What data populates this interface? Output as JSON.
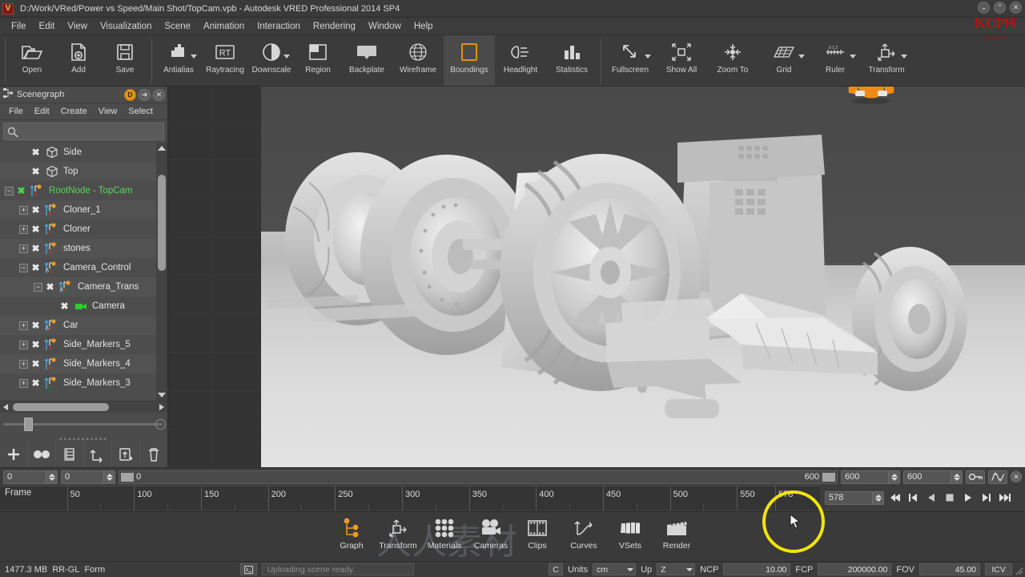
{
  "window": {
    "title": "D:/Work/VRed/Power vs Speed/Main Shot/TopCam.vpb - Autodesk VRED Professional 2014 SP4",
    "app_icon": "vred-icon",
    "controls": {
      "minimize": "⌄",
      "maximize": "⌃",
      "close": "✕"
    },
    "logo": "KUPH",
    "logo_sub": "video tutorials"
  },
  "menubar": {
    "items": [
      "File",
      "Edit",
      "View",
      "Visualization",
      "Scene",
      "Animation",
      "Interaction",
      "Rendering",
      "Window",
      "Help"
    ]
  },
  "toolbar": {
    "groups": [
      {
        "buttons": [
          {
            "label": "Open",
            "icon": "folder-open-icon",
            "caret": false,
            "active": false
          },
          {
            "label": "Add",
            "icon": "add-file-icon",
            "caret": false,
            "active": false
          },
          {
            "label": "Save",
            "icon": "floppy-disk-icon",
            "caret": false,
            "active": false
          }
        ]
      },
      {
        "buttons": [
          {
            "label": "Antialias",
            "icon": "antialias-icon",
            "caret": true,
            "active": false
          },
          {
            "label": "Raytracing",
            "icon": "rt-icon",
            "caret": false,
            "active": false
          },
          {
            "label": "Downscale",
            "icon": "downscale-icon",
            "caret": true,
            "active": false
          },
          {
            "label": "Region",
            "icon": "region-icon",
            "caret": false,
            "active": false
          },
          {
            "label": "Backplate",
            "icon": "backplate-icon",
            "caret": false,
            "active": false
          },
          {
            "label": "Wireframe",
            "icon": "wireframe-globe-icon",
            "caret": false,
            "active": false
          },
          {
            "label": "Boundings",
            "icon": "boundings-icon",
            "caret": false,
            "active": true
          },
          {
            "label": "Headlight",
            "icon": "headlight-icon",
            "caret": false,
            "active": false
          },
          {
            "label": "Statistics",
            "icon": "statistics-bars-icon",
            "caret": false,
            "active": false
          }
        ]
      },
      {
        "buttons": [
          {
            "label": "Fullscreen",
            "icon": "fullscreen-arrows-icon",
            "caret": true,
            "active": false
          },
          {
            "label": "Show All",
            "icon": "show-all-icon",
            "caret": false,
            "active": false
          },
          {
            "label": "Zoom To",
            "icon": "zoom-to-icon",
            "caret": false,
            "active": false
          },
          {
            "label": "Grid",
            "icon": "grid-plane-icon",
            "caret": true,
            "active": false
          },
          {
            "label": "Ruler",
            "icon": "ruler-icon",
            "caret": true,
            "active": false
          },
          {
            "label": "Transform",
            "icon": "transform-icon",
            "caret": true,
            "active": false
          }
        ]
      }
    ]
  },
  "scenegraph": {
    "title": "Scenegraph",
    "panel_icon": "scenegraph-icon",
    "header_buttons": [
      {
        "name": "dock-d-button",
        "glyph": "D"
      },
      {
        "name": "undock-button",
        "glyph": "➜"
      },
      {
        "name": "close-panel-button",
        "glyph": "✕"
      }
    ],
    "menu": [
      "File",
      "Edit",
      "Create",
      "View",
      "Select"
    ],
    "search": {
      "placeholder": "",
      "value": "",
      "icon": "search-icon"
    },
    "nodes": [
      {
        "label": "Side",
        "indent": 1,
        "expander": "none",
        "icon": "box-icon",
        "selected": false,
        "visible": true
      },
      {
        "label": "Top",
        "indent": 1,
        "expander": "none",
        "icon": "box-icon",
        "selected": false,
        "visible": true
      },
      {
        "label": "RootNode - TopCam",
        "indent": 0,
        "expander": "minus",
        "icon": "transform-node-icon",
        "selected": true,
        "visible": true
      },
      {
        "label": "Cloner_1",
        "indent": 1,
        "expander": "plus",
        "icon": "transform-node-icon",
        "selected": false,
        "visible": true
      },
      {
        "label": "Cloner",
        "indent": 1,
        "expander": "plus",
        "icon": "transform-node-icon",
        "selected": false,
        "visible": true
      },
      {
        "label": "stones",
        "indent": 1,
        "expander": "plus",
        "icon": "transform-node-icon",
        "selected": false,
        "visible": true
      },
      {
        "label": "Camera_Control",
        "indent": 1,
        "expander": "minus",
        "icon": "transform-anim-node-icon",
        "selected": false,
        "visible": true
      },
      {
        "label": "Camera_Trans",
        "indent": 2,
        "expander": "minus",
        "icon": "transform-anim-node-icon",
        "selected": false,
        "visible": true
      },
      {
        "label": "Camera",
        "indent": 3,
        "expander": "none",
        "icon": "camera-icon",
        "selected": false,
        "visible": true
      },
      {
        "label": "Car",
        "indent": 1,
        "expander": "plus",
        "icon": "transform-anim-node-icon",
        "selected": false,
        "visible": true
      },
      {
        "label": "Side_Markers_5",
        "indent": 1,
        "expander": "plus",
        "icon": "transform-node-icon",
        "selected": false,
        "visible": true
      },
      {
        "label": "Side_Markers_4",
        "indent": 1,
        "expander": "plus",
        "icon": "transform-node-icon",
        "selected": false,
        "visible": true
      },
      {
        "label": "Side_Markers_3",
        "indent": 1,
        "expander": "plus",
        "icon": "transform-node-icon",
        "selected": false,
        "visible": true
      }
    ],
    "bottom_buttons": [
      {
        "name": "add-node-button",
        "icon": "plus-icon"
      },
      {
        "name": "group-nodes-button",
        "icon": "two-circles-icon"
      },
      {
        "name": "align-nodes-button",
        "icon": "align-icon"
      },
      {
        "name": "move-node-button",
        "icon": "move-up-arrow-icon"
      },
      {
        "name": "clone-node-button",
        "icon": "clipboard-arrow-icon"
      },
      {
        "name": "delete-node-button",
        "icon": "trash-icon"
      }
    ]
  },
  "timeline": {
    "start_field": "0",
    "end_field": "0",
    "range_left_value": "0",
    "range_right_value": "600",
    "anim_end_1": "600",
    "anim_end_2": "600",
    "frame_label": "Frame",
    "ticks": [
      "50",
      "100",
      "150",
      "200",
      "250",
      "300",
      "350",
      "400",
      "450",
      "500",
      "550"
    ],
    "current_frame": "578",
    "current_frame_field": "578",
    "key_button": "key-icon",
    "curve_button": "animation-curve-icon",
    "close_button": "✕",
    "transport": [
      {
        "name": "go-to-start-button",
        "icon": "skip-back-icon"
      },
      {
        "name": "previous-key-button",
        "icon": "step-back-icon"
      },
      {
        "name": "play-reverse-button",
        "icon": "play-reverse-icon"
      },
      {
        "name": "stop-button",
        "icon": "stop-icon"
      },
      {
        "name": "play-button",
        "icon": "play-icon"
      },
      {
        "name": "next-key-button",
        "icon": "step-forward-icon"
      },
      {
        "name": "go-to-end-button",
        "icon": "skip-forward-icon"
      }
    ]
  },
  "bottom_toolbar": {
    "buttons": [
      {
        "label": "Graph",
        "icon": "graph-nodes-icon",
        "active": true
      },
      {
        "label": "Transform",
        "icon": "transform-icon",
        "active": false
      },
      {
        "label": "Materials",
        "icon": "material-dots-icon",
        "active": false
      },
      {
        "label": "Cameras",
        "icon": "movie-camera-icon",
        "active": false
      },
      {
        "label": "Clips",
        "icon": "film-clip-icon",
        "active": false
      },
      {
        "label": "Curves",
        "icon": "curve-icon",
        "active": false
      },
      {
        "label": "VSets",
        "icon": "vsets-cards-icon",
        "active": false
      },
      {
        "label": "Render",
        "icon": "clapperboard-icon",
        "active": false
      }
    ]
  },
  "statusbar": {
    "memory": "1477.3 MB",
    "renderer": "RR-GL",
    "mode": "Form",
    "console_icon": "console-icon",
    "message": "Uploading scene ready.",
    "c_button": "C",
    "units_label": "Units",
    "units_value": "cm",
    "up_label": "Up",
    "up_value": "Z",
    "ncp_label": "NCP",
    "ncp_value": "10.00",
    "fcp_label": "FCP",
    "fcp_value": "200000.00",
    "fov_label": "FOV",
    "fov_value": "45.00",
    "icv_button": "ICV"
  },
  "viewport": {
    "name": "3d-viewport",
    "scene_description": "Grey clay-shaded hot rod car render",
    "gizmo": "view-cube-gizmo"
  },
  "colors": {
    "accent": "#e0921a",
    "highlight_ring": "#f2e40c",
    "panel": "#4b4b4b",
    "toolbar": "#3b3b3b",
    "selected_node": "#5ad45a"
  }
}
